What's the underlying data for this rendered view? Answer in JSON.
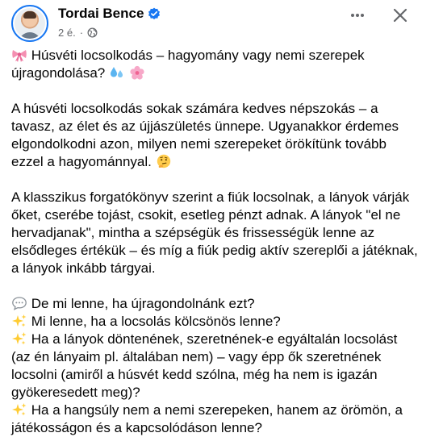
{
  "post": {
    "author": "Tordai Bence",
    "time": "2 é.",
    "dot": "·",
    "icons": {
      "verified": "verified-badge-icon",
      "audience": "globe-icon",
      "more": "more-options-icon",
      "close": "close-icon"
    },
    "accent": "#1877f2"
  },
  "body": {
    "p1": {
      "emoji_lead": "ribbon-emoji",
      "text": "Húsvéti locsolkodás – hagyomány vagy nemi szerepek újragondolása?",
      "emoji_trail": [
        "sweat-droplets-emoji",
        "blossom-emoji"
      ]
    },
    "p2": {
      "text": "A húsvéti locsolkodás sokak számára kedves népszokás – a tavasz, az élet és az újjászületés ünnepe. Ugyanakkor érdemes elgondolkodni azon, milyen nemi szerepeket örökítünk tovább ezzel a hagyománnyal.",
      "emoji_trail": "thinking-face-emoji"
    },
    "p3": {
      "text": "A klasszikus forgatókönyv szerint a fiúk locsolnak, a lányok várják őket, cserébe tojást, csokit, esetleg pénzt adnak. A lányok \"el ne hervadjanak\", mintha a szépségük és frissességük lenne az elsődleges értékük – és míg a fiúk pedig aktív szereplői a játéknak, a lányok inkább tárgyai."
    },
    "p4": {
      "line1": "De mi lenne, ha újragondolnánk ezt?",
      "line1_emoji": "speech-bubble-emoji",
      "line2": "Mi lenne, ha a locsolás kölcsönös lenne?",
      "line3": "Ha a lányok döntenének, szeretnének-e egyáltalán locsolást (az én lányaim pl. általában nem) – vagy épp ők szeretnének locsolni (amiről a húsvét kedd szólna, még ha nem is igazán gyökeresedett meg)?",
      "line4": "Ha a hangsúly nem a nemi szerepeken, hanem az örömön, a játékosságon és a kapcsolódáson lenne?",
      "sparkle_emoji": "sparkles-emoji"
    }
  }
}
